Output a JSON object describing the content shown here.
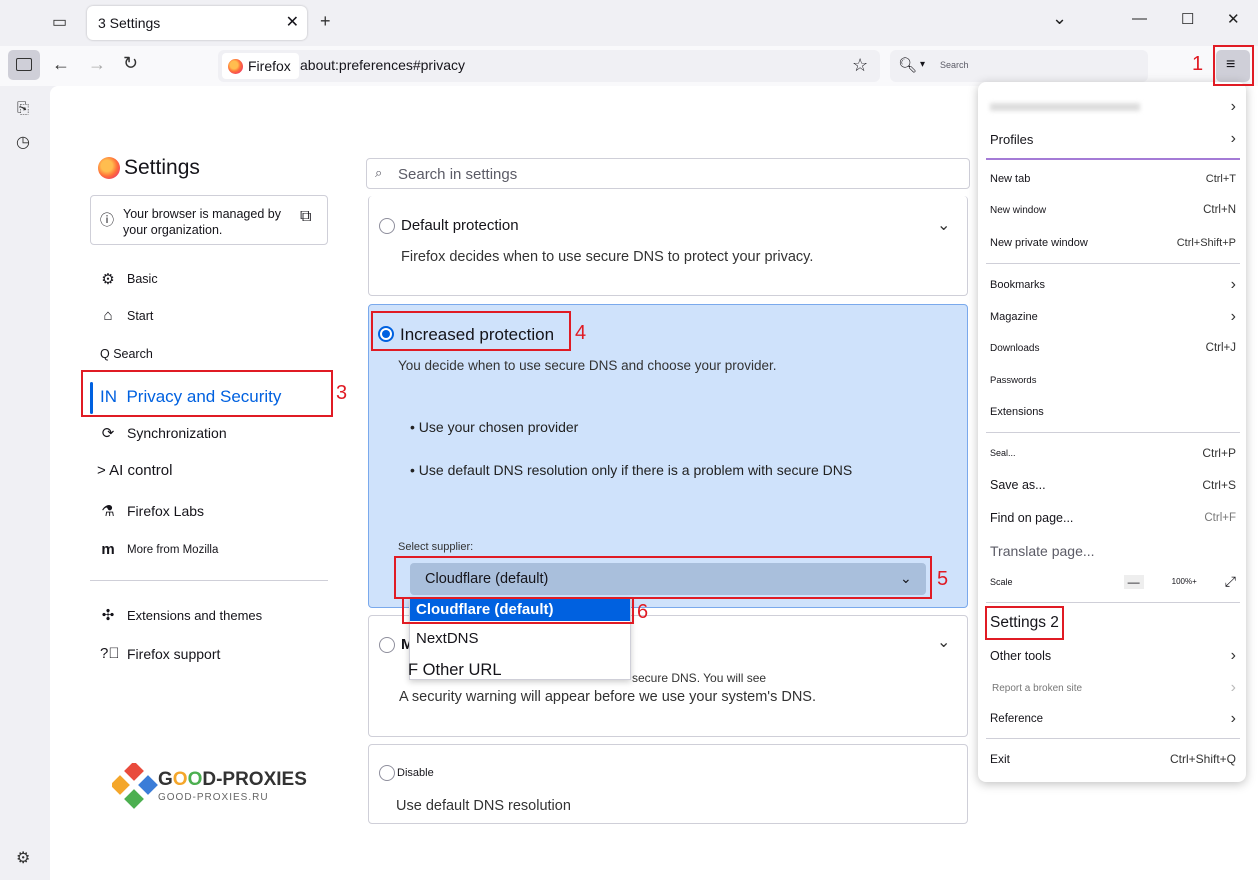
{
  "browser": {
    "tab_title": "3 Settings",
    "tab_close": "✕",
    "new_tab": "+",
    "url_identity": "Firefox",
    "url": "about:preferences#privacy",
    "search_placeholder": "Search",
    "win_min": "—",
    "win_max": "☐",
    "win_close": "✕",
    "tab_list": "⌄"
  },
  "settings": {
    "title": "Settings",
    "managed_notice": "Your browser is managed by your organization.",
    "search_placeholder": "Search in settings",
    "categories": {
      "basic": "Basic",
      "start": "Start",
      "search": "Q Search",
      "privacy": "IN  Privacy and Security",
      "sync": "Synchronization",
      "ai": "> AI control",
      "labs": "Firefox Labs",
      "more": "More from Mozilla",
      "extensions": "Extensions and themes",
      "support": "Firefox support"
    },
    "dns": {
      "default_label": "Default protection",
      "default_desc": "Firefox decides when to use secure DNS to protect your privacy.",
      "increased_label": "Increased protection",
      "increased_desc": "You decide when to use secure DNS and choose your provider.",
      "bullet1": "• Use your chosen provider",
      "bullet2": "• Use default DNS resolution only if there is a problem with secure DNS",
      "select_label": "Select supplier:",
      "selected_value": "Cloudflare (default)",
      "options": [
        "Cloudflare (default)",
        "NextDNS",
        "F Other URL"
      ],
      "max_label": "M",
      "max_desc_partial": "secure DNS. You will see",
      "max_desc": "A security warning will appear before we use your system's DNS.",
      "off_label": "Disable",
      "off_desc": "Use default DNS resolution"
    }
  },
  "annotations": {
    "n1": "1",
    "n2": "2",
    "n3": "3",
    "n4": "4",
    "n5": "5",
    "n6": "6"
  },
  "logo": {
    "name_part1": "G",
    "name_part2": "D-PROXIES",
    "site": "GOOD-PROXIES.RU"
  },
  "app_menu": {
    "account_blurred": " ",
    "profiles": "Profiles",
    "new_tab": "New tab",
    "new_tab_sc": "Ctrl+T",
    "new_window": "New window",
    "new_window_sc": "Ctrl+N",
    "new_private": "New private window",
    "new_private_sc": "Ctrl+Shift+P",
    "bookmarks": "Bookmarks",
    "magazine": "Magazine",
    "downloads": "Downloads",
    "downloads_sc": "Ctrl+J",
    "passwords": "Passwords",
    "extensions": "Extensions",
    "seal": "Seal...",
    "seal_sc": "Ctrl+P",
    "save_as": "Save as...",
    "save_as_sc": "Ctrl+S",
    "find": "Find on page...",
    "find_sc": "Ctrl+F",
    "translate": "Translate page...",
    "scale": "Scale",
    "zoom_minus": "—",
    "zoom_value": "100%+",
    "settings": "Settings 2",
    "other_tools": "Other tools",
    "report": "Report a broken site",
    "reference": "Reference",
    "exit": "Exit",
    "exit_sc": "Ctrl+Shift+Q"
  },
  "colors": {
    "accent": "#0061e0",
    "annotation_red": "#e01b24",
    "selected_card": "#cfe2fb"
  }
}
